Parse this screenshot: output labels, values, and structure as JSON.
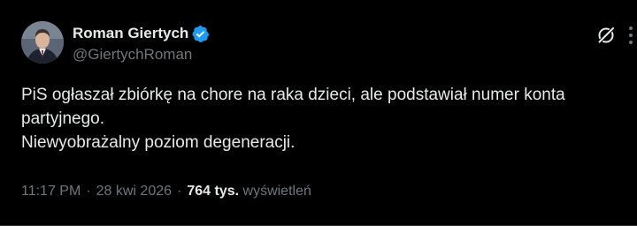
{
  "author": {
    "display_name": "Roman Giertych",
    "handle": "@GiertychRoman",
    "verified": true,
    "verified_color": "#1d9bf0"
  },
  "tweet": {
    "lines": [
      "PiS ogłaszał zbiórkę na chore na raka dzieci, ale podstawiał numer konta",
      "partyjnego.",
      "Niewyobrażalny poziom degeneracji."
    ]
  },
  "meta": {
    "time": "11:17 PM",
    "separator": "·",
    "date": "28 kwi 2026",
    "views_count": "764 tys.",
    "views_label": "wyświetleń"
  },
  "icons": {
    "verified": "verified-badge-icon",
    "grok": "grok-icon",
    "more": "more-options-icon"
  },
  "colors": {
    "background": "#000000",
    "text_primary": "#e7e9ea",
    "text_secondary": "#71767b",
    "accent": "#1d9bf0"
  }
}
